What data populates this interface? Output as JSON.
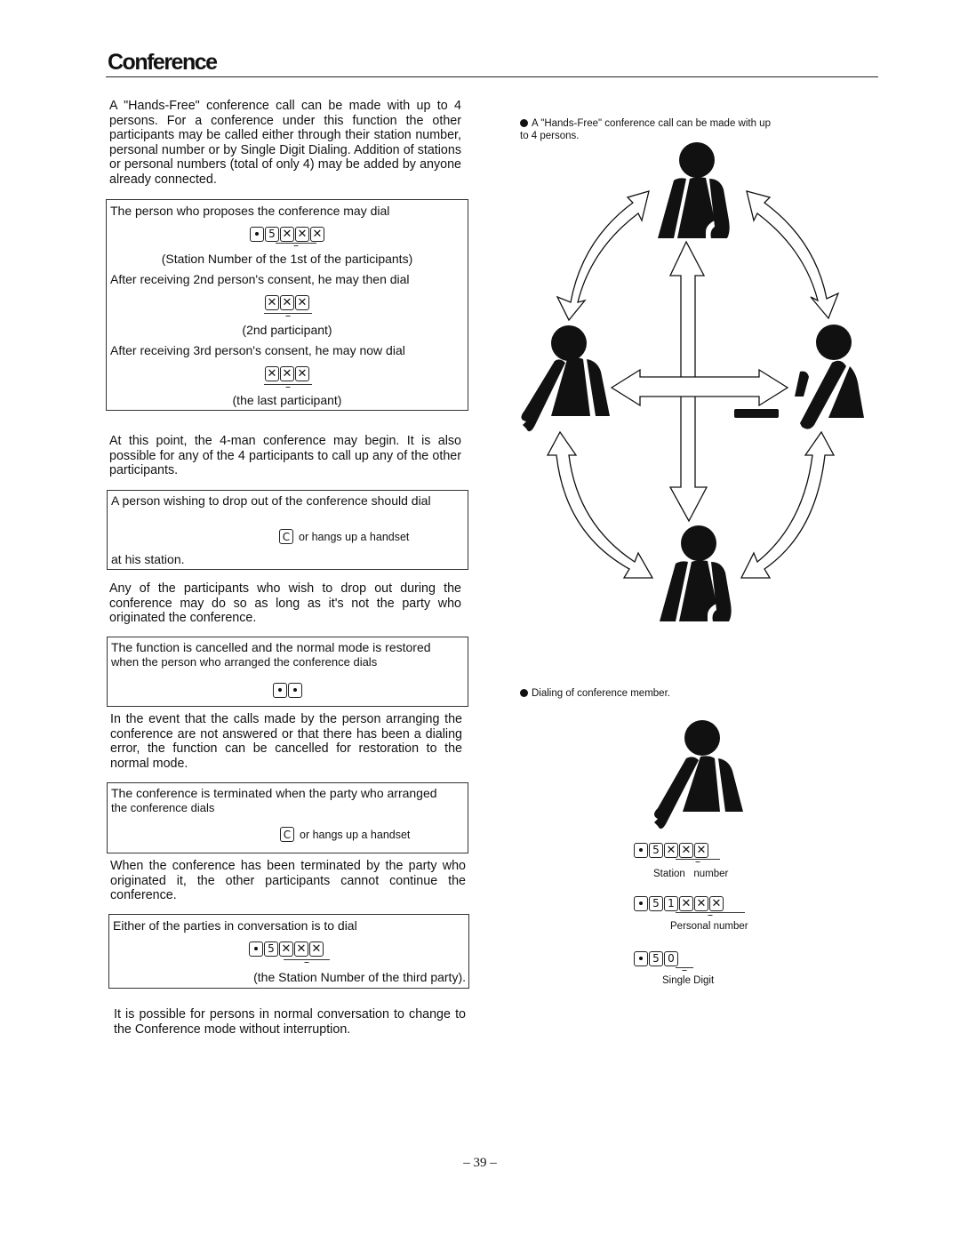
{
  "page": {
    "title": "Conference",
    "page_number": "– 39 –"
  },
  "left": {
    "intro": "A \"Hands-Free\" conference call can be made with up to 4 persons. For a conference under this function the other participants may be called either through their station number, personal number or by Single Digit Dialing. Addition of stations or personal numbers (total of only 4) may be added by anyone already connected.",
    "box1": {
      "line1": "The person who proposes the conference may dial",
      "keys1": [
        "•",
        "5",
        "×",
        "×",
        "×"
      ],
      "caption1": "(Station Number of the 1st of the participants)",
      "line2": "After receiving 2nd person's consent, he may then dial",
      "keys2": [
        "×",
        "×",
        "×"
      ],
      "caption2": "(2nd participant)",
      "line3": "After receiving 3rd person's consent, he may now dial",
      "keys3": [
        "×",
        "×",
        "×"
      ],
      "caption3": "(the last participant)"
    },
    "para2": "At this point, the 4-man conference may begin. It is also possible for any of the 4 participants to call up any of the other participants.",
    "box2": {
      "line1": "A person wishing to drop out of the conference should dial",
      "key": "C",
      "key_suffix": "or hangs up a handset",
      "line3": "at his station."
    },
    "para3": "Any of the participants who wish to drop out during the conference may do so as long as it's not the party who originated the conference.",
    "box3": {
      "line1": "The function is cancelled and the normal mode is restored",
      "line2": "when the person who arranged the conference dials",
      "keys": [
        "•",
        "•"
      ]
    },
    "para4": "In the event that the calls made by the person arranging the conference are not answered or that there has been a dialing error, the function can be cancelled for restoration to the normal mode.",
    "box4": {
      "line1": "The conference is terminated when the party who arranged",
      "line2": "the conference dials",
      "key": "C",
      "key_suffix": "or hangs up a handset"
    },
    "para5": "When the conference has been terminated by the party who originated it, the other participants cannot continue the conference.",
    "box5": {
      "line1": "Either of the parties in conversation is to dial",
      "keys": [
        "•",
        "5",
        "×",
        "×",
        "×"
      ],
      "caption": "(the Station Number of the third party)."
    },
    "para6": "It is possible for persons in normal conversation to change to the Conference mode without interruption."
  },
  "right": {
    "figure1_caption": "A \"Hands-Free\" conference call can be made with up to 4 persons.",
    "figure2_caption": "Dialing of conference member.",
    "dial_examples": [
      {
        "keys": [
          "•",
          "5",
          "×",
          "×",
          "×"
        ],
        "label": "Station   number"
      },
      {
        "keys": [
          "•",
          "5",
          "1",
          "×",
          "×",
          "×"
        ],
        "label": "Personal number"
      },
      {
        "keys": [
          "•",
          "5",
          "0"
        ],
        "label": "Single Digit"
      }
    ]
  }
}
